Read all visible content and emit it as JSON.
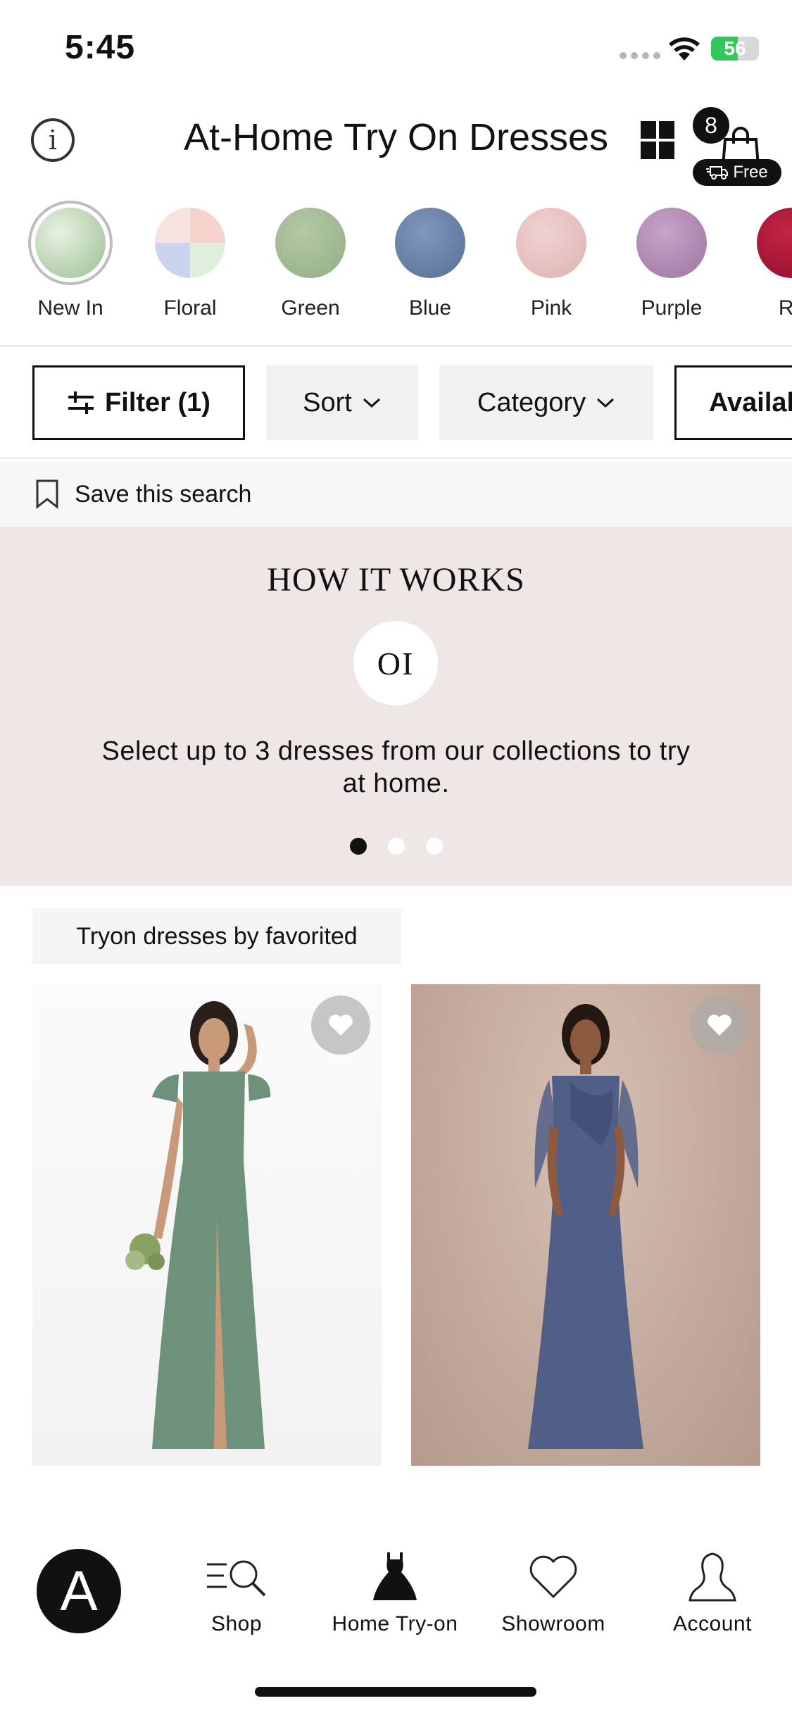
{
  "status_bar": {
    "time": "5:45",
    "battery": "56",
    "battery_level": 0.56
  },
  "header": {
    "title": "At-Home Try On Dresses",
    "cart_count": "8",
    "shipping_badge": "Free"
  },
  "colors": {
    "items": [
      {
        "label": "New In",
        "selected": true
      },
      {
        "label": "Floral",
        "selected": false
      },
      {
        "label": "Green",
        "selected": false
      },
      {
        "label": "Blue",
        "selected": false
      },
      {
        "label": "Pink",
        "selected": false
      },
      {
        "label": "Purple",
        "selected": false
      },
      {
        "label": "Re",
        "selected": false
      }
    ]
  },
  "filters": {
    "filter_label": "Filter (1)",
    "sort_label": "Sort",
    "category_label": "Category",
    "availability_label": "Availal"
  },
  "save_search": {
    "label": "Save this search"
  },
  "how_it_works": {
    "title": "HOW IT WORKS",
    "step": "OI",
    "text": "Select up to 3 dresses from our collections to try at home.",
    "active_slide": 1,
    "slide_count": 3
  },
  "products": {
    "section_label": "Tryon dresses by favorited",
    "items": [
      {
        "dress_color": "#6e917b"
      },
      {
        "dress_color": "#515f87"
      }
    ]
  },
  "tabbar": {
    "logo": "A",
    "shop": "Shop",
    "home_tryon": "Home Try-on",
    "showroom": "Showroom",
    "account": "Account"
  }
}
